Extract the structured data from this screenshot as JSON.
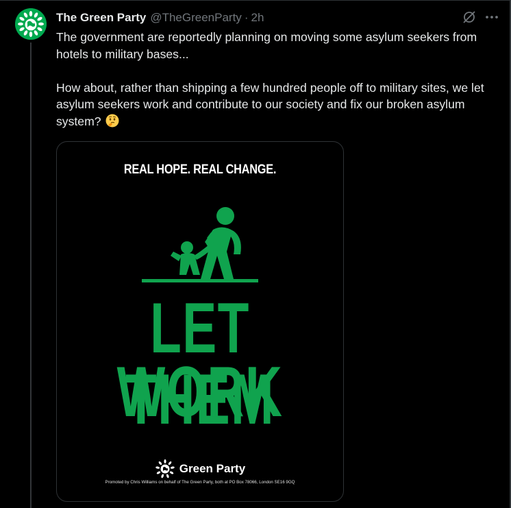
{
  "tweet": {
    "display_name": "The Green Party",
    "handle": "@TheGreenParty",
    "separator": "·",
    "time": "2h",
    "text_paragraphs": [
      "The government are reportedly planning on moving some asylum seekers from hotels to military bases...",
      "How about, rather than shipping a few hundred people off to military sites, we let asylum seekers work and contribute to our society and fix our broken asylum system?"
    ],
    "emoji": "thinking-face"
  },
  "media": {
    "tagline": "REAL HOPE. REAL CHANGE.",
    "headline_line1": "LET THEM",
    "headline_line2": "WORK",
    "brand_name": "Green Party",
    "imprint": "Promoted by Chris Williams on behalf of The Green Party, both at PO Box 78066, London SE16 9GQ"
  },
  "icons": {
    "avatar": "green-party-logo",
    "grok": "grok-icon",
    "more": "more-options-icon"
  },
  "colors": {
    "background": "#000000",
    "text": "#e7e9ea",
    "muted": "#71767b",
    "brand_green": "#10a34e",
    "avatar_green": "#00a94f"
  }
}
